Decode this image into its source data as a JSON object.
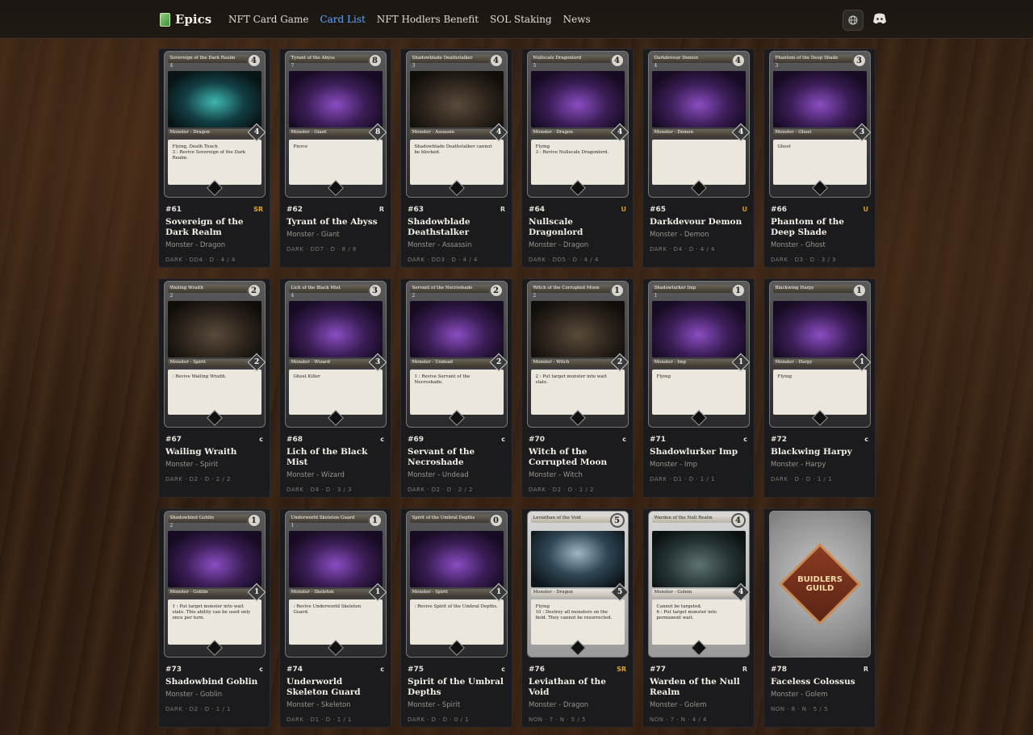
{
  "brand": {
    "name": "Epics"
  },
  "nav": [
    "NFT Card Game",
    "Card List",
    "NFT Hodlers Benefit",
    "SOL Staking",
    "News"
  ],
  "nav_active": "Card List",
  "cards": [
    {
      "no": "#61",
      "rarity": "SR",
      "name": "Sovereign of the Dark Realm",
      "type": "Monster - Dragon",
      "stats": "DARK · DD4 · D · 4 / 4",
      "cost": "4",
      "gems": "4",
      "power": "4",
      "text": "Flying, Death Touch\n3 : Revive Sovereign of the Dark Realm.",
      "art": "teal"
    },
    {
      "no": "#62",
      "rarity": "R",
      "name": "Tyrant of the Abyss",
      "type": "Monster - Giant",
      "stats": "DARK · DD7 · D · 8 / 8",
      "cost": "8",
      "gems": "7",
      "power": "8",
      "text": "Pierce",
      "art": "purple"
    },
    {
      "no": "#63",
      "rarity": "R",
      "name": "Shadowblade Deathstalker",
      "type": "Monster - Assassin",
      "stats": "DARK · DD3 · D · 4 / 4",
      "cost": "4",
      "gems": "3",
      "power": "4",
      "text": "Shadowblade Deathstalker cannot be blocked.",
      "art": "dim"
    },
    {
      "no": "#64",
      "rarity": "U",
      "name": "Nullscale Dragonlord",
      "type": "Monster - Dragon",
      "stats": "DARK · DD5 · D · 4 / 4",
      "cost": "4",
      "gems": "5",
      "power": "4",
      "text": "Flying\n3 : Revive Nullscale Dragonlord.",
      "art": "purple"
    },
    {
      "no": "#65",
      "rarity": "U",
      "name": "Darkdevour Demon",
      "type": "Monster - Demon",
      "stats": "DARK · D4 · D · 4 / 4",
      "cost": "4",
      "gems": "4",
      "power": "4",
      "text": "",
      "art": "purple"
    },
    {
      "no": "#66",
      "rarity": "U",
      "name": "Phantom of the Deep Shade",
      "type": "Monster - Ghost",
      "stats": "DARK · D3 · D · 3 / 3",
      "cost": "3",
      "gems": "3",
      "power": "3",
      "text": "Ghost",
      "art": "purple"
    },
    {
      "no": "#67",
      "rarity": "C",
      "name": "Wailing Wraith",
      "type": "Monster - Spirit",
      "stats": "DARK · D2 · D · 2 / 2",
      "cost": "2",
      "gems": "2",
      "power": "2",
      "text": ": Revive Wailing Wraith.",
      "art": "dim"
    },
    {
      "no": "#68",
      "rarity": "C",
      "name": "Lich of the Black Mist",
      "type": "Monster - Wizard",
      "stats": "DARK · D4 · D · 3 / 3",
      "cost": "3",
      "gems": "4",
      "power": "3",
      "text": "Ghost Killer",
      "art": "purple"
    },
    {
      "no": "#69",
      "rarity": "C",
      "name": "Servant of the Necroshade",
      "type": "Monster - Undead",
      "stats": "DARK · D2 · D · 2 / 2",
      "cost": "2",
      "gems": "2",
      "power": "2",
      "text": "1 : Revive Servant of the Necroshade.",
      "art": "purple"
    },
    {
      "no": "#70",
      "rarity": "C",
      "name": "Witch of the Corrupted Moon",
      "type": "Monster - Witch",
      "stats": "DARK · D2 · D · 1 / 2",
      "cost": "1",
      "gems": "2",
      "power": "2",
      "text": "2 : Put target monster into wait state.",
      "art": "dim"
    },
    {
      "no": "#71",
      "rarity": "C",
      "name": "Shadowlurker Imp",
      "type": "Monster - Imp",
      "stats": "DARK · D1 · D · 1 / 1",
      "cost": "1",
      "gems": "1",
      "power": "1",
      "text": "Flying",
      "art": "purple"
    },
    {
      "no": "#72",
      "rarity": "C",
      "name": "Blackwing Harpy",
      "type": "Monster - Harpy",
      "stats": "DARK · D · D · 1 / 1",
      "cost": "1",
      "gems": "",
      "power": "1",
      "text": "Flying",
      "art": "purple"
    },
    {
      "no": "#73",
      "rarity": "C",
      "name": "Shadowbind Goblin",
      "type": "Monster - Goblin",
      "stats": "DARK · D2 · D · 1 / 1",
      "cost": "1",
      "gems": "2",
      "power": "1",
      "text": "1 : Put target monster into wait state. This ability can be used only once per turn.",
      "art": "purple"
    },
    {
      "no": "#74",
      "rarity": "C",
      "name": "Underworld Skeleton Guard",
      "type": "Monster - Skeleton",
      "stats": "DARK · D1 · D · 1 / 1",
      "cost": "1",
      "gems": "1",
      "power": "1",
      "text": ": Revive Underworld Skeleton Guard.",
      "art": "purple"
    },
    {
      "no": "#75",
      "rarity": "C",
      "name": "Spirit of the Umbral Depths",
      "type": "Monster - Spirit",
      "stats": "DARK · D · D · 0 / 1",
      "cost": "0",
      "gems": "",
      "power": "1",
      "text": ": Revive Spirit of the Umbral Depths.",
      "art": "purple"
    },
    {
      "no": "#76",
      "rarity": "SR",
      "name": "Leviathan of the Void",
      "type": "Monster - Dragon",
      "stats": "NON · 7 · N · 5 / 5",
      "cost": "5",
      "gems": "7",
      "power": "5",
      "text": "Flying\n10 : Destroy all monsters on the field. They cannot be resurrected.",
      "art": "storm",
      "light": true
    },
    {
      "no": "#77",
      "rarity": "R",
      "name": "Warden of the Null Realm",
      "type": "Monster - Golem",
      "stats": "NON · 7 · N · 4 / 4",
      "cost": "4",
      "gems": "7",
      "power": "4",
      "text": "Cannot be targeted.\n6 : Put target monster into permanent wait.",
      "art": "ogre",
      "light": true
    },
    {
      "no": "#78",
      "rarity": "R",
      "name": "Faceless Colossus",
      "type": "Monster - Golem",
      "stats": "NON · 8 · N · 5 / 5",
      "back": true,
      "back_text": "BUIDLERS GUILD"
    }
  ]
}
